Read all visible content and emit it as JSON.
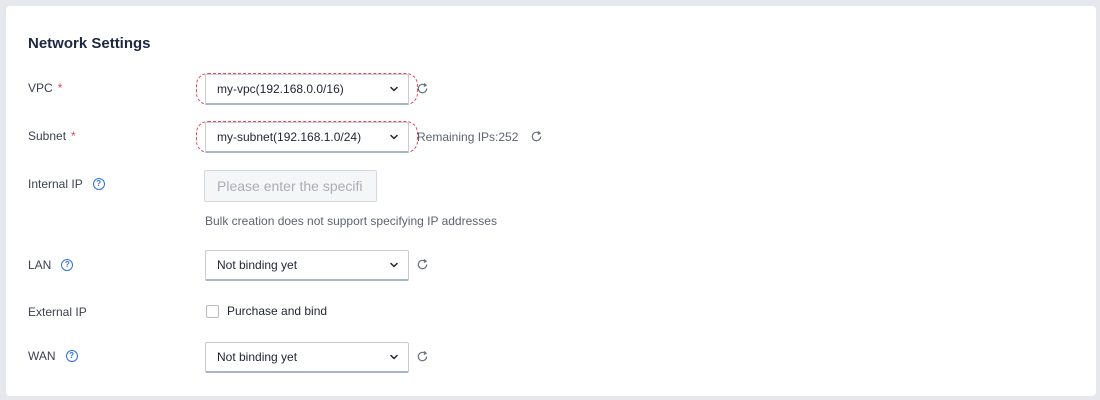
{
  "section": {
    "title": "Network Settings"
  },
  "vpc": {
    "label": "VPC",
    "required_mark": "*",
    "selected": "my-vpc(192.168.0.0/16)"
  },
  "subnet": {
    "label": "Subnet",
    "required_mark": "*",
    "selected": "my-subnet(192.168.1.0/24)",
    "remaining_ips": "Remaining IPs:252"
  },
  "internal_ip": {
    "label": "Internal IP",
    "placeholder": "Please enter the specifi",
    "hint": "Bulk creation does not support specifying IP addresses"
  },
  "lan": {
    "label": "LAN",
    "selected": "Not binding yet"
  },
  "external_ip": {
    "label": "External IP",
    "checkbox_label": "Purchase and bind",
    "checked": false
  },
  "wan": {
    "label": "WAN",
    "selected": "Not binding yet"
  },
  "icons": {
    "help": "?",
    "refresh": "refresh-icon",
    "dropdown": "chevron-down-icon"
  },
  "colors": {
    "required": "#e5484d",
    "help_icon": "#2f6fdf",
    "error_outline": "#e5484d"
  }
}
